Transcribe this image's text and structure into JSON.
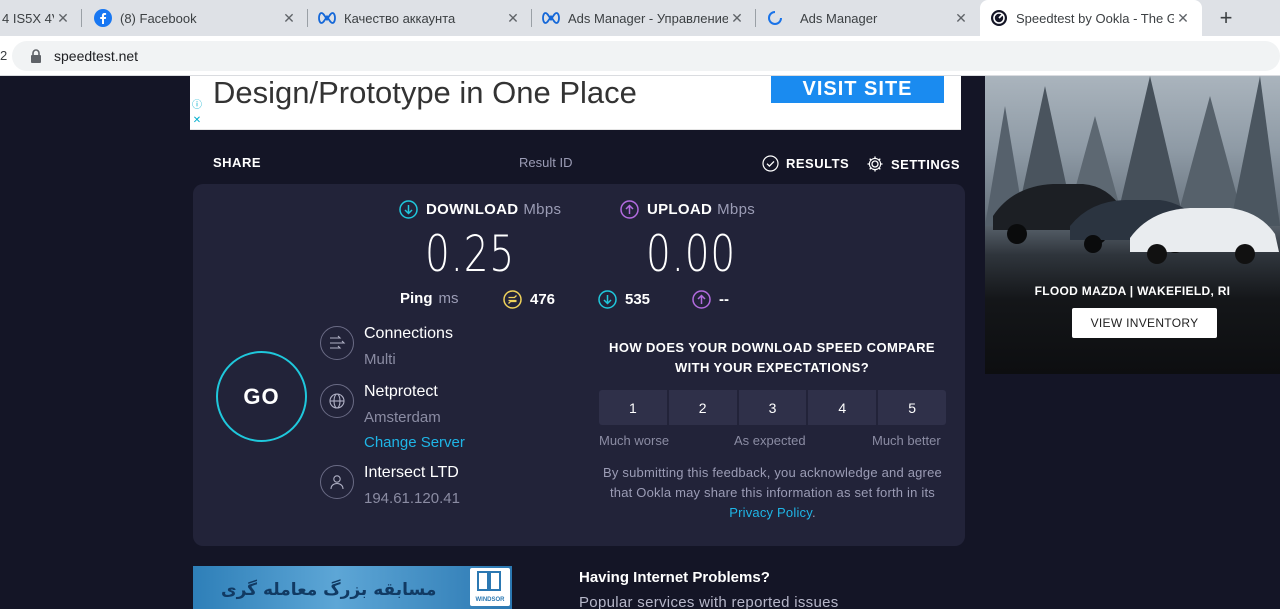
{
  "browser": {
    "tabs": [
      {
        "title": "4 IS5X 4V",
        "favicon": "unknown-favicon"
      },
      {
        "title": "(8) Facebook",
        "favicon": "facebook-icon"
      },
      {
        "title": "Качество аккаунта",
        "favicon": "meta-icon"
      },
      {
        "title": "Ads Manager - Управление",
        "favicon": "meta-icon"
      },
      {
        "title": "Ads Manager",
        "favicon": "loading-icon"
      },
      {
        "title": "Speedtest by Ookla - The G",
        "favicon": "speedtest-icon",
        "active": true
      }
    ],
    "new_tab": "+",
    "close_glyph": "✕",
    "address_prefix": "2",
    "url": "speedtest.net"
  },
  "top_ad": {
    "headline": "Design/Prototype in One Place",
    "cta": "VISIT SITE",
    "info_glyph": "ⓘ",
    "close_glyph": "✕"
  },
  "right_ad": {
    "dealer": "FLOOD MAZDA | WAKEFIELD, RI",
    "cta": "VIEW INVENTORY"
  },
  "nav": {
    "share": "SHARE",
    "result_id": "Result ID",
    "results": "RESULTS",
    "settings": "SETTINGS"
  },
  "download": {
    "label": "DOWNLOAD",
    "unit": "Mbps",
    "value": "0.25"
  },
  "upload": {
    "label": "UPLOAD",
    "unit": "Mbps",
    "value": "0.00"
  },
  "ping": {
    "label": "Ping",
    "unit": "ms",
    "idle": "476",
    "download": "535",
    "upload": "--"
  },
  "go_label": "GO",
  "connections": {
    "title": "Connections",
    "value": "Multi"
  },
  "server": {
    "title": "Netprotect",
    "location": "Amsterdam",
    "change": "Change Server"
  },
  "isp": {
    "title": "Intersect LTD",
    "ip": "194.61.120.41"
  },
  "survey": {
    "question": "HOW DOES YOUR DOWNLOAD SPEED COMPARE WITH YOUR EXPECTATIONS?",
    "options": [
      "1",
      "2",
      "3",
      "4",
      "5"
    ],
    "low": "Much worse",
    "mid": "As expected",
    "high": "Much better",
    "disclaimer": "By submitting this feedback, you acknowledge and agree that Ookla may share this information as set forth in its",
    "privacy_link": "Privacy Policy",
    "period": "."
  },
  "bottom_ad": {
    "text": "مسابقه بزرگ معامله گری",
    "brand": "WINDSOR"
  },
  "problems": {
    "title": "Having Internet Problems?",
    "subtitle": "Popular services with reported issues"
  },
  "colors": {
    "background": "#141526",
    "card": "#222339",
    "accent_cyan": "#1fc8dc",
    "upload_purple": "#b26bdf",
    "ping_yellow": "#f0d35b",
    "link_blue": "#1fb5e6"
  }
}
